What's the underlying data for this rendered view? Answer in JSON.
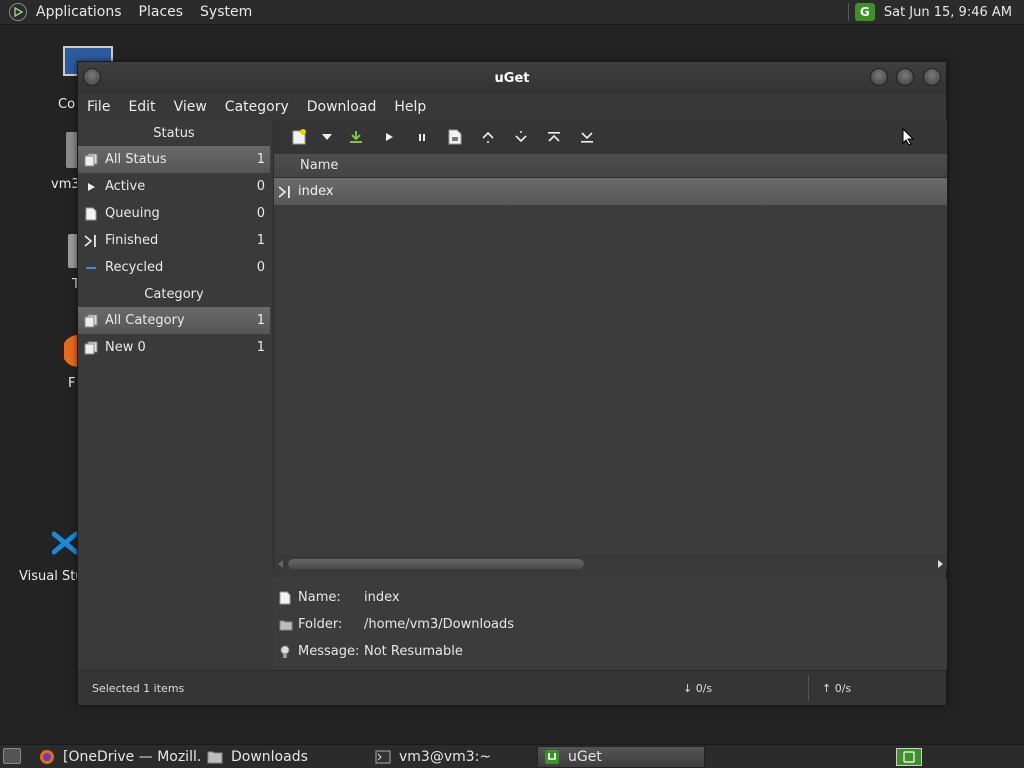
{
  "top_panel": {
    "menus": [
      "Applications",
      "Places",
      "System"
    ],
    "clock": "Sat Jun 15,  9:46 AM",
    "tray_icon_text": "G"
  },
  "desktop": {
    "icons": [
      {
        "name": "computer-icon",
        "label": "Co"
      },
      {
        "name": "home-folder-icon",
        "label": "vm3"
      },
      {
        "name": "trash-icon",
        "label": "T"
      },
      {
        "name": "firefox-icon",
        "label": "F"
      },
      {
        "name": "vscode-icon",
        "label": "Visual Stu"
      }
    ]
  },
  "window": {
    "title": "uGet",
    "menu": [
      "File",
      "Edit",
      "View",
      "Category",
      "Download",
      "Help"
    ],
    "sidebar": {
      "status_header": "Status",
      "status_items": [
        {
          "label": "All Status",
          "count": "1",
          "icon": "all-status-icon"
        },
        {
          "label": "Active",
          "count": "0",
          "icon": "play-icon"
        },
        {
          "label": "Queuing",
          "count": "0",
          "icon": "document-icon"
        },
        {
          "label": "Finished",
          "count": "1",
          "icon": "finished-icon"
        },
        {
          "label": "Recycled",
          "count": "0",
          "icon": "recycled-icon"
        }
      ],
      "category_header": "Category",
      "category_items": [
        {
          "label": "All Category",
          "count": "1"
        },
        {
          "label": "New 0",
          "count": "1"
        }
      ]
    },
    "toolbar": [
      "new-download-icon",
      "dropdown-arrow-icon",
      "batch-download-icon",
      "start-icon",
      "pause-icon",
      "properties-icon",
      "move-up-icon",
      "move-down-icon",
      "move-top-icon",
      "move-bottom-icon"
    ],
    "list": {
      "column_header": "Name",
      "rows": [
        {
          "name": "index",
          "icon": "finished-icon"
        }
      ]
    },
    "details": {
      "name_label": "Name:",
      "name_value": "index",
      "folder_label": "Folder:",
      "folder_value": "/home/vm3/Downloads",
      "message_label": "Message:",
      "message_value": "Not Resumable"
    },
    "statusbar": {
      "selected": "Selected 1 items",
      "down_speed": "↓  0/s",
      "up_speed": "↑  0/s"
    }
  },
  "bottom_panel": {
    "tasks": [
      {
        "label": "[OneDrive — Mozill...",
        "icon": "firefox-icon"
      },
      {
        "label": "Downloads",
        "icon": "folder-icon"
      },
      {
        "label": "vm3@vm3:~",
        "icon": "terminal-icon"
      },
      {
        "label": "uGet",
        "icon": "uget-icon",
        "active": true
      }
    ]
  },
  "colors": {
    "accent_green": "#3f8f2c",
    "selection": "#5f5f5f",
    "window_bg": "#3a3a3a"
  }
}
